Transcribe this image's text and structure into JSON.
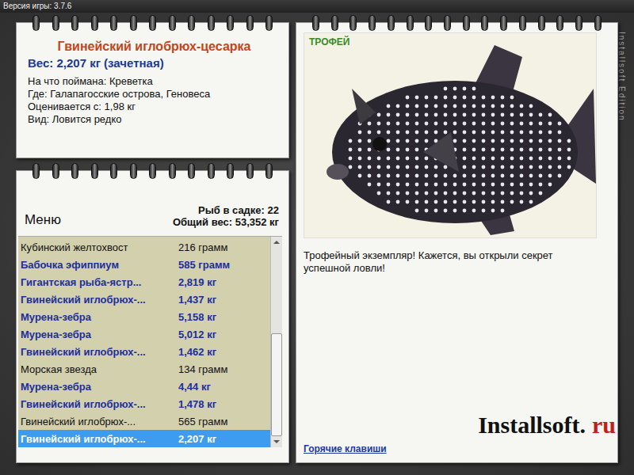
{
  "version": "Версия игры: 3.7.6",
  "watermark": "Installsoft Edition",
  "fish": {
    "title": "Гвинейский иглобрюх-цесарка",
    "weight": "Вес: 2,207 кг (зачетная)",
    "details": [
      "На что поймана: Креветка",
      "Где: Галапагосские острова, Геновеса",
      "Оценивается с: 1,98 кг",
      "Вид: Ловится редко"
    ]
  },
  "menu": {
    "title": "Меню",
    "count": "Рыб в садке: 22",
    "total": "Общий вес: 53,352 кг"
  },
  "catch_list": {
    "rows": [
      {
        "name": "Кубинский желтохвост",
        "weight": "216 грамм",
        "trophy": false,
        "selected": false
      },
      {
        "name": "Бабочка эфиппиум",
        "weight": "585 грамм",
        "trophy": true,
        "selected": false
      },
      {
        "name": "Гигантская рыба-ястр...",
        "weight": "2,819 кг",
        "trophy": true,
        "selected": false
      },
      {
        "name": "Гвинейский иглобрюх-...",
        "weight": "1,437 кг",
        "trophy": true,
        "selected": false
      },
      {
        "name": "Мурена-зебра",
        "weight": "5,158 кг",
        "trophy": true,
        "selected": false
      },
      {
        "name": "Мурена-зебра",
        "weight": "5,012 кг",
        "trophy": true,
        "selected": false
      },
      {
        "name": "Гвинейский иглобрюх-...",
        "weight": "1,462 кг",
        "trophy": true,
        "selected": false
      },
      {
        "name": "Морская звезда",
        "weight": "134 грамм",
        "trophy": false,
        "selected": false
      },
      {
        "name": "Мурена-зебра",
        "weight": "4,44 кг",
        "trophy": true,
        "selected": false
      },
      {
        "name": "Гвинейский иглобрюх-...",
        "weight": "1,478 кг",
        "trophy": true,
        "selected": false
      },
      {
        "name": "Гвинейский иглобрюх-...",
        "weight": "565 грамм",
        "trophy": false,
        "selected": false
      },
      {
        "name": "Гвинейский иглобрюх-...",
        "weight": "2,207 кг",
        "trophy": true,
        "selected": true
      }
    ],
    "scrollbar": {
      "level": 1
    }
  },
  "trophy": {
    "badge": "ТРОФЕЙ",
    "message": "Трофейный экземпляр! Кажется, вы открыли секрет успешной ловли!"
  },
  "hotkeys_link": "Горячие клавиши",
  "logo": {
    "name": "Installsoft.",
    "suffix": "ru"
  }
}
